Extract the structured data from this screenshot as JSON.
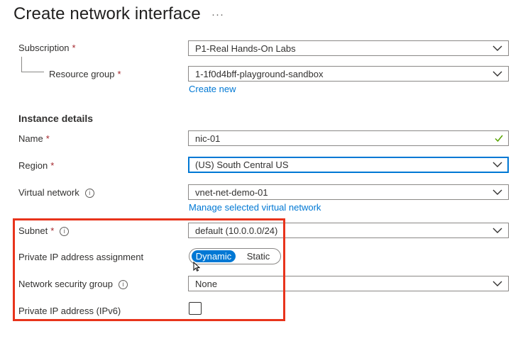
{
  "header": {
    "title": "Create network interface",
    "more_label": "···"
  },
  "project": {
    "subscription": {
      "label": "Subscription",
      "required_mark": "*",
      "value": "P1-Real Hands-On Labs"
    },
    "resource_group": {
      "label": "Resource group",
      "required_mark": "*",
      "value": "1-1f0d4bff-playground-sandbox",
      "create_new_link": "Create new"
    }
  },
  "instance": {
    "section_title": "Instance details",
    "name": {
      "label": "Name",
      "required_mark": "*",
      "value": "nic-01"
    },
    "region": {
      "label": "Region",
      "required_mark": "*",
      "value": "(US) South Central US"
    },
    "virtual_network": {
      "label": "Virtual network",
      "info_glyph": "i",
      "value": "vnet-net-demo-01",
      "manage_link": "Manage selected virtual network"
    },
    "subnet": {
      "label": "Subnet",
      "required_mark": "*",
      "info_glyph": "i",
      "value": "default (10.0.0.0/24)"
    },
    "ip_assignment": {
      "label": "Private IP address assignment",
      "options": [
        "Dynamic",
        "Static"
      ],
      "selected": "Dynamic"
    },
    "nsg": {
      "label": "Network security group",
      "info_glyph": "i",
      "value": "None"
    },
    "ipv6": {
      "label": "Private IP address (IPv6)",
      "checked": false
    }
  },
  "colors": {
    "accent": "#0078d4",
    "required": "#a4262c",
    "valid_check": "#57a300",
    "highlight": "#e8341c"
  },
  "icons": {
    "dropdown": "chevron-down-icon",
    "valid": "checkmark-icon",
    "info": "info-icon",
    "pointer": "mouse-pointer-icon"
  }
}
